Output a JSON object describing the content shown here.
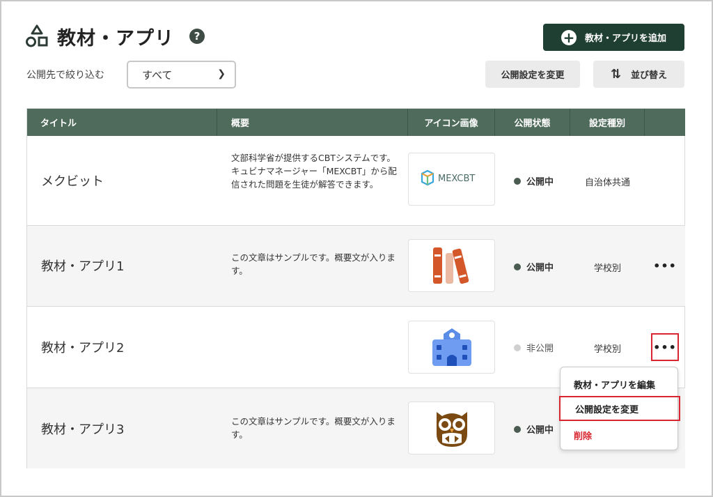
{
  "header": {
    "title": "教材・アプリ",
    "help_glyph": "?",
    "add_button_label": "教材・アプリを追加"
  },
  "filter": {
    "label": "公開先で絞り込む",
    "selected": "すべて"
  },
  "toolbar": {
    "change_visibility_label": "公開設定を変更",
    "sort_label": "並び替え"
  },
  "table": {
    "columns": [
      "タイトル",
      "概要",
      "アイコン画像",
      "公開状態",
      "設定種別",
      ""
    ],
    "rows": [
      {
        "title": "メクビット",
        "description": "文部科学省が提供するCBTシステムです。キュビナマネージャー「MEXCBT」から配信された問題を生徒が解答できます。",
        "icon": "mexcbt-logo",
        "icon_text": "MEXCBT",
        "status": "公開中",
        "kind": "自治体共通"
      },
      {
        "title": "教材・アプリ1",
        "description": "この文章はサンプルです。概要文が入ります。",
        "icon": "books-icon",
        "status": "公開中",
        "kind": "学校別"
      },
      {
        "title": "教材・アプリ2",
        "description": "",
        "icon": "school-building-icon",
        "status": "非公開",
        "kind": "学校別"
      },
      {
        "title": "教材・アプリ3",
        "description": "この文章はサンプルです。概要文が入ります。",
        "icon": "owl-icon",
        "status": "公開中",
        "kind": ""
      }
    ]
  },
  "context_menu": {
    "items": [
      "教材・アプリを編集",
      "公開設定を変更",
      "削除"
    ]
  },
  "colors": {
    "primary": "#1f3f32",
    "table_header": "#4e6b5c",
    "published_dot": "#4a5c52",
    "unpublished_dot": "#d0d0d0",
    "danger": "#d9252f",
    "highlight": "#d9252f"
  },
  "more_glyph": "•••"
}
